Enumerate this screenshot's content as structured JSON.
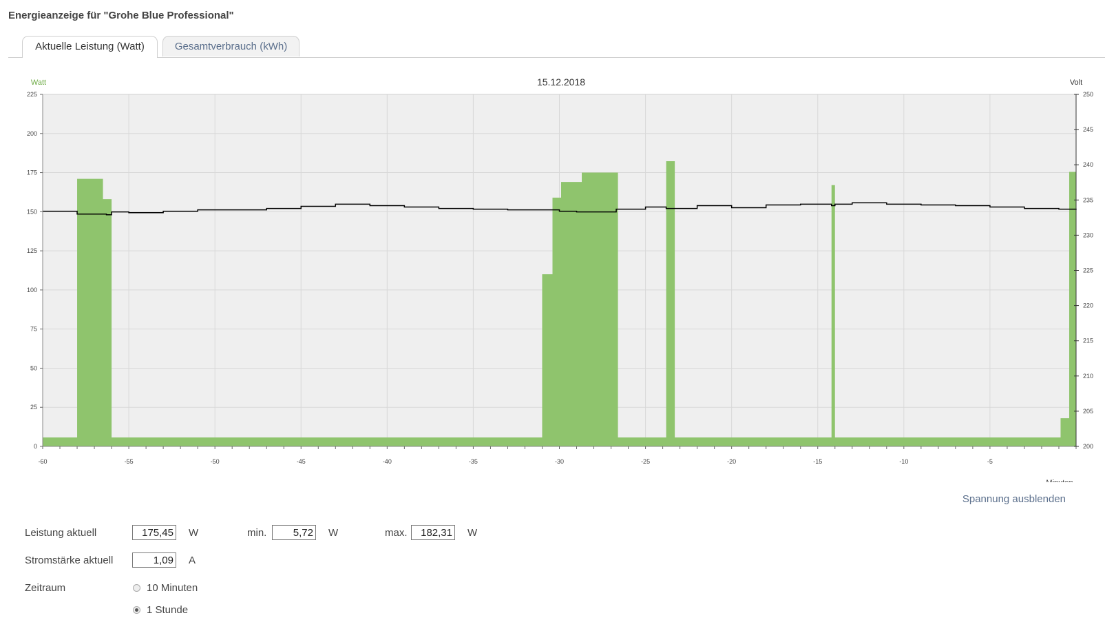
{
  "page": {
    "title": "Energieanzeige für \"Grohe Blue Professional\""
  },
  "tabs": [
    {
      "label": "Aktuelle Leistung (Watt)",
      "active": true
    },
    {
      "label": "Gesamtverbrauch (kWh)",
      "active": false
    }
  ],
  "colors": {
    "power": "#8fc46d",
    "voltage": "#000000",
    "plot_bg": "#efefef",
    "grid": "#d8d8d8",
    "link": "#5b6f8c"
  },
  "chart_data": {
    "type": "bar",
    "title": "15.12.2018",
    "xlabel": "Minuten",
    "ylabel": "Watt",
    "y2label": "Volt",
    "xlim": [
      -60,
      0
    ],
    "ylim": [
      0,
      225
    ],
    "y2lim": [
      200,
      250
    ],
    "x_ticks": [
      -60,
      -55,
      -50,
      -45,
      -40,
      -35,
      -30,
      -25,
      -20,
      -15,
      -10,
      -5
    ],
    "y_ticks": [
      0,
      25,
      50,
      75,
      100,
      125,
      150,
      175,
      200,
      225
    ],
    "y2_ticks": [
      200,
      205,
      210,
      215,
      220,
      225,
      230,
      235,
      240,
      245,
      250
    ],
    "grid": true,
    "series": [
      {
        "name": "Watt",
        "type": "area-step",
        "axis": "left",
        "points": [
          [
            -60,
            5.7
          ],
          [
            -58,
            171
          ],
          [
            -56.5,
            158
          ],
          [
            -56,
            5.7
          ],
          [
            -31,
            110
          ],
          [
            -30.4,
            159
          ],
          [
            -29.9,
            169
          ],
          [
            -28.7,
            175
          ],
          [
            -26.6,
            5.7
          ],
          [
            -23.8,
            182.3
          ],
          [
            -23.3,
            5.7
          ],
          [
            -14.2,
            167
          ],
          [
            -14,
            5.7
          ],
          [
            -0.9,
            18
          ],
          [
            -0.4,
            175.45
          ],
          [
            0,
            175.45
          ]
        ]
      },
      {
        "name": "Volt",
        "type": "step-line",
        "axis": "right",
        "points": [
          [
            -60,
            233.4
          ],
          [
            -58,
            233.0
          ],
          [
            -57,
            233.0
          ],
          [
            -56.3,
            232.9
          ],
          [
            -56,
            233.3
          ],
          [
            -55,
            233.2
          ],
          [
            -53,
            233.4
          ],
          [
            -51,
            233.6
          ],
          [
            -47,
            233.8
          ],
          [
            -45,
            234.1
          ],
          [
            -43,
            234.4
          ],
          [
            -41,
            234.2
          ],
          [
            -39,
            234.0
          ],
          [
            -37,
            233.8
          ],
          [
            -35,
            233.7
          ],
          [
            -33,
            233.6
          ],
          [
            -31,
            233.6
          ],
          [
            -30,
            233.4
          ],
          [
            -29,
            233.3
          ],
          [
            -26.7,
            233.7
          ],
          [
            -25,
            234.0
          ],
          [
            -23.8,
            233.8
          ],
          [
            -23.3,
            233.8
          ],
          [
            -22,
            234.2
          ],
          [
            -20,
            233.9
          ],
          [
            -18,
            234.3
          ],
          [
            -16,
            234.4
          ],
          [
            -14.2,
            234.2
          ],
          [
            -14,
            234.4
          ],
          [
            -13,
            234.6
          ],
          [
            -11,
            234.4
          ],
          [
            -9,
            234.3
          ],
          [
            -7,
            234.2
          ],
          [
            -5,
            234.0
          ],
          [
            -3,
            233.8
          ],
          [
            -1,
            233.7
          ],
          [
            0,
            233.6
          ]
        ]
      }
    ]
  },
  "controls": {
    "toggle_voltage": "Spannung ausblenden",
    "power_current_label": "Leistung aktuell",
    "power_current_value": "175,45",
    "min_label": "min.",
    "min_value": "5,72",
    "max_label": "max.",
    "max_value": "182,31",
    "unit_w": "W",
    "current_label": "Stromstärke aktuell",
    "current_value": "1,09",
    "unit_a": "A",
    "period_label": "Zeitraum",
    "period_options": [
      {
        "label": "10 Minuten",
        "checked": false
      },
      {
        "label": "1 Stunde",
        "checked": true
      }
    ]
  }
}
